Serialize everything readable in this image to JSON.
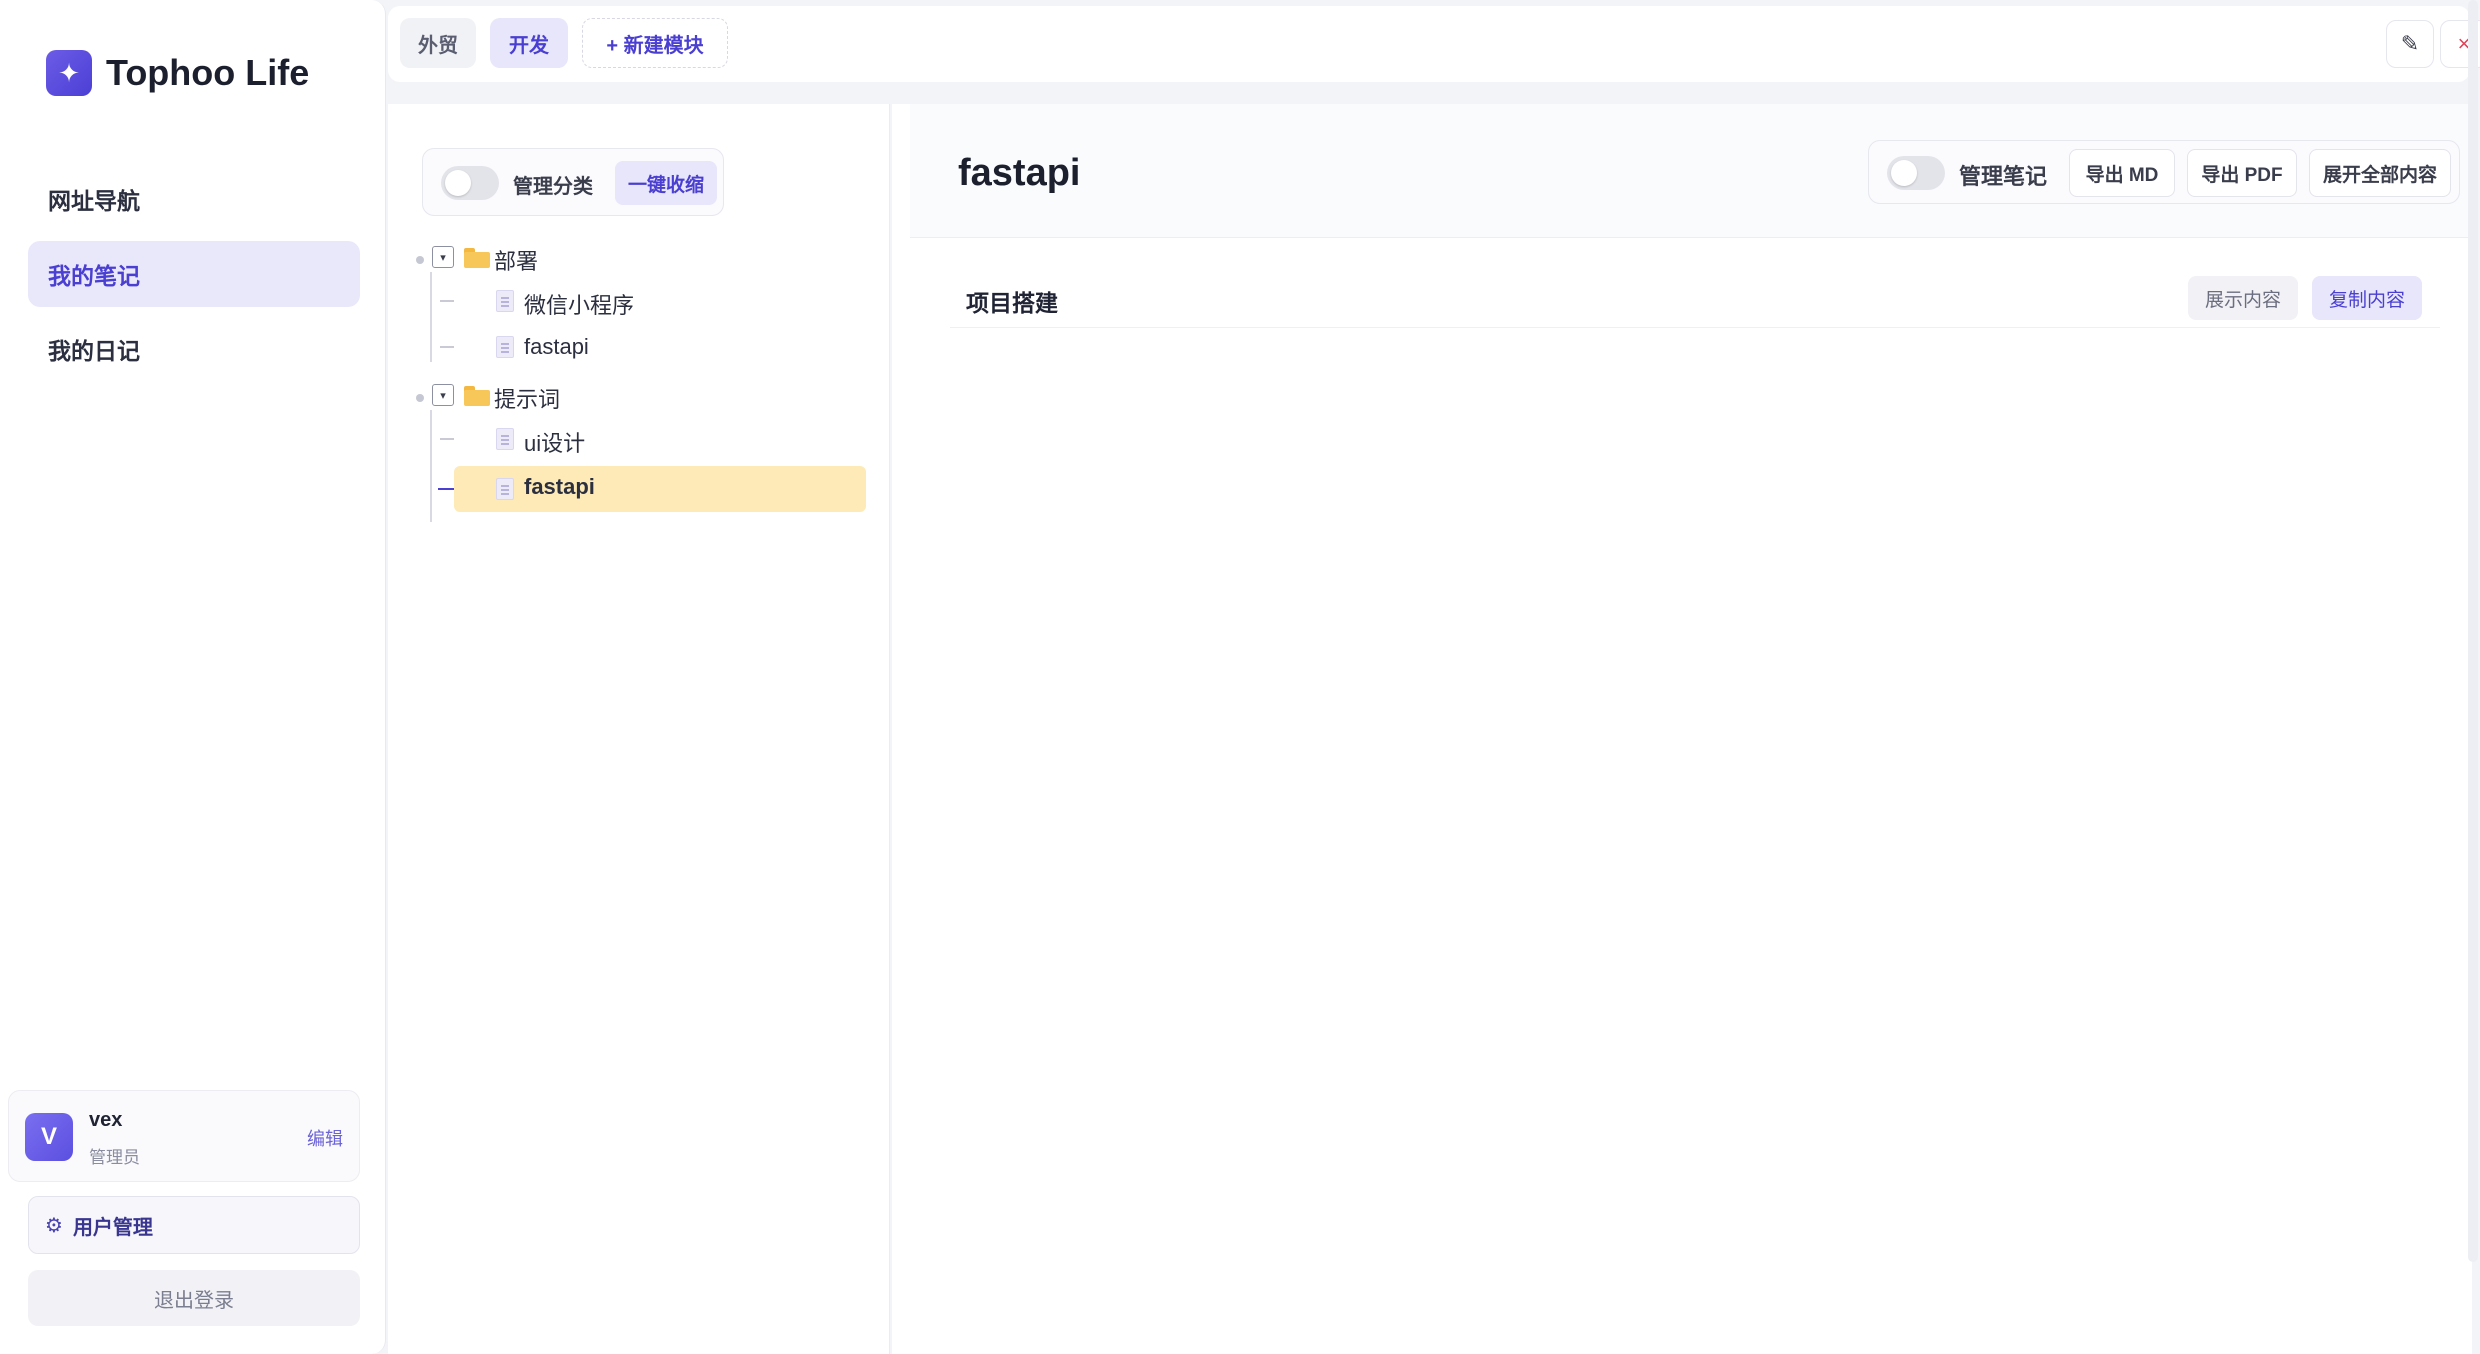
{
  "brand": {
    "name": "Tophoo Life",
    "logo_icon": "✦"
  },
  "nav": {
    "items": [
      {
        "label": "网址导航",
        "active": false
      },
      {
        "label": "我的笔记",
        "active": true
      },
      {
        "label": "我的日记",
        "active": false
      }
    ]
  },
  "user": {
    "avatar_letter": "V",
    "name": "vex",
    "role": "管理员",
    "edit_label": "编辑"
  },
  "sidebar_footer": {
    "user_mgmt_icon": "⚙",
    "user_mgmt_label": "用户管理",
    "logout_label": "退出登录"
  },
  "modules": {
    "tabs": [
      {
        "label": "外贸",
        "active": false
      },
      {
        "label": "开发",
        "active": true
      }
    ],
    "new_label": "+ 新建模块",
    "edit_icon": "✎",
    "close_icon": "×"
  },
  "tree_toolbar": {
    "toggle_label": "管理分类",
    "collapse_label": "一键收缩"
  },
  "tree": {
    "expander_glyph": "▾",
    "folders": [
      {
        "name": "部署",
        "children": [
          "微信小程序",
          "fastapi"
        ]
      },
      {
        "name": "提示词",
        "children": [
          "ui设计",
          "fastapi"
        ]
      }
    ],
    "selected": "fastapi"
  },
  "note": {
    "title": "fastapi",
    "toggle_label": "管理笔记",
    "export_md": "导出 MD",
    "export_pdf": "导出 PDF",
    "expand_all": "展开全部内容"
  },
  "section": {
    "title": "项目搭建",
    "show_label": "展示内容",
    "copy_label": "复制内容"
  },
  "colors": {
    "accent": "#4a3fd0",
    "accent_soft": "#e9e8fb",
    "selected_node": "#fdeab6",
    "danger": "#e0435a"
  }
}
